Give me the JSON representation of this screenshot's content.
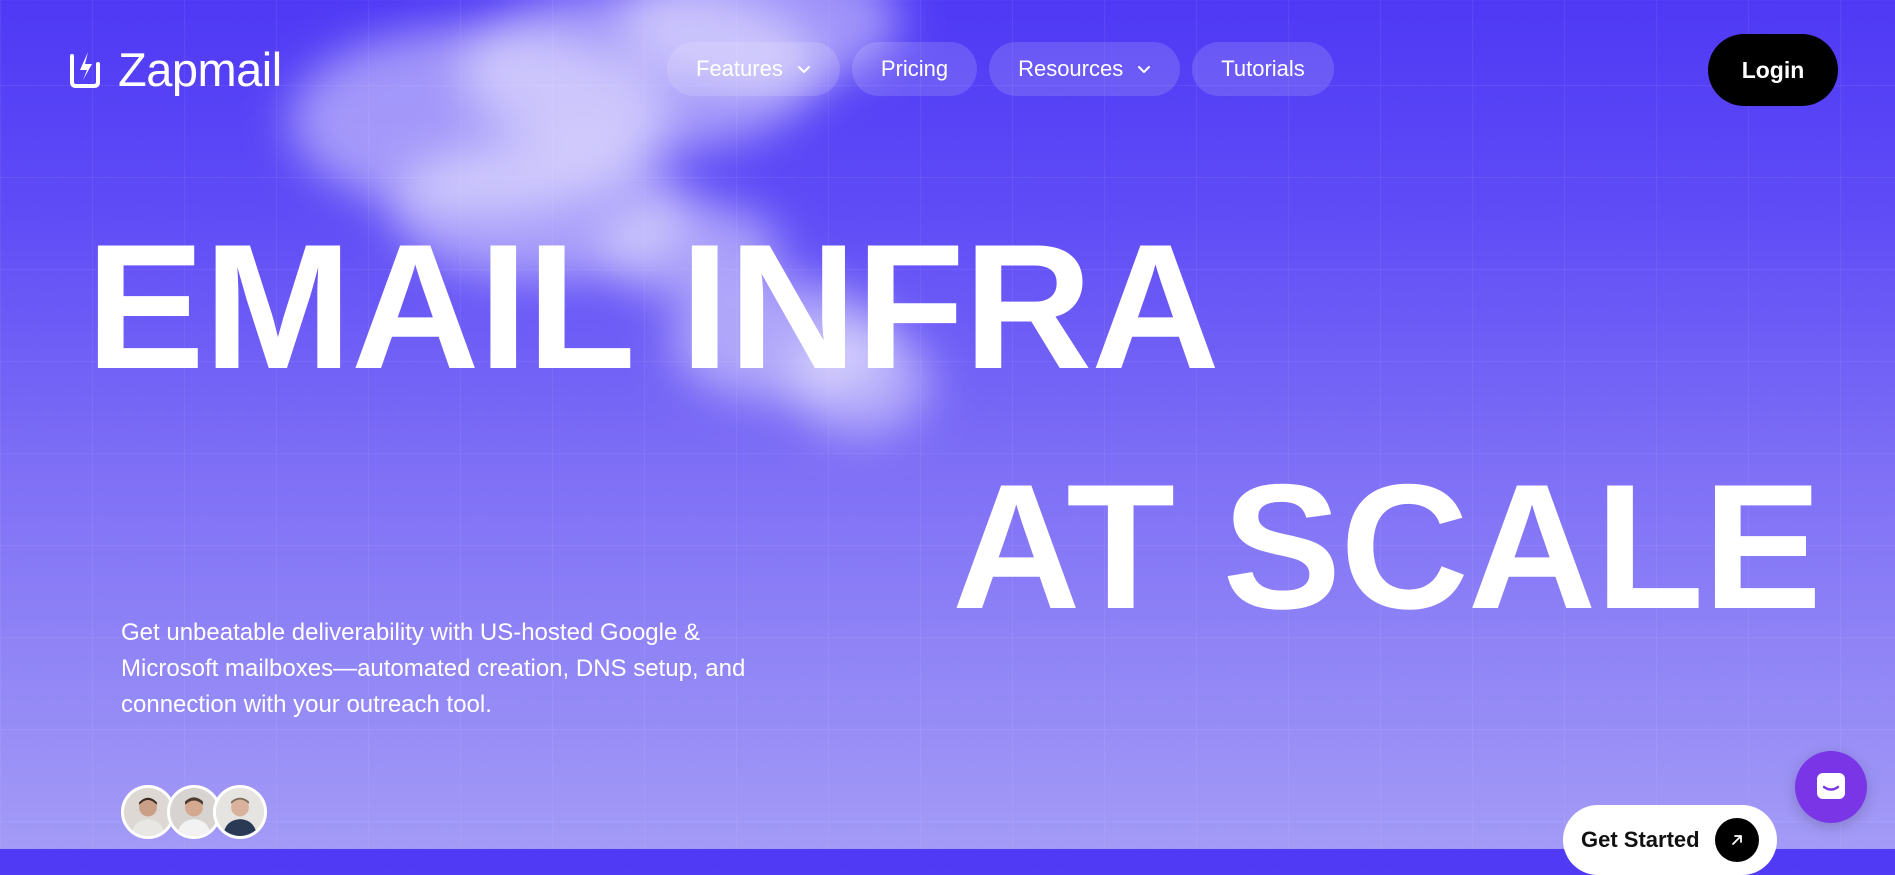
{
  "brand": {
    "name": "Zapmail",
    "logo_icon": "power-bolt-icon"
  },
  "nav": {
    "items": [
      {
        "label": "Features",
        "has_dropdown": true
      },
      {
        "label": "Pricing",
        "has_dropdown": false
      },
      {
        "label": "Resources",
        "has_dropdown": true
      },
      {
        "label": "Tutorials",
        "has_dropdown": false
      }
    ],
    "login_label": "Login"
  },
  "hero": {
    "headline_line1": "EMAIL INFRA",
    "headline_line2": "AT SCALE",
    "subtext": "Get unbeatable deliverability with US-hosted Google & Microsoft mailboxes—automated creation, DNS setup, and connection with your outreach tool.",
    "cta_label": "Get Started",
    "cta_icon": "arrow-up-right-icon",
    "avatar_count": 3
  },
  "chat": {
    "icon": "chat-bubble-icon"
  },
  "colors": {
    "bg_top": "#4f39f5",
    "bg_bottom": "#a39bf6",
    "login_bg": "#000000",
    "chat_bg": "#7a35e6"
  }
}
